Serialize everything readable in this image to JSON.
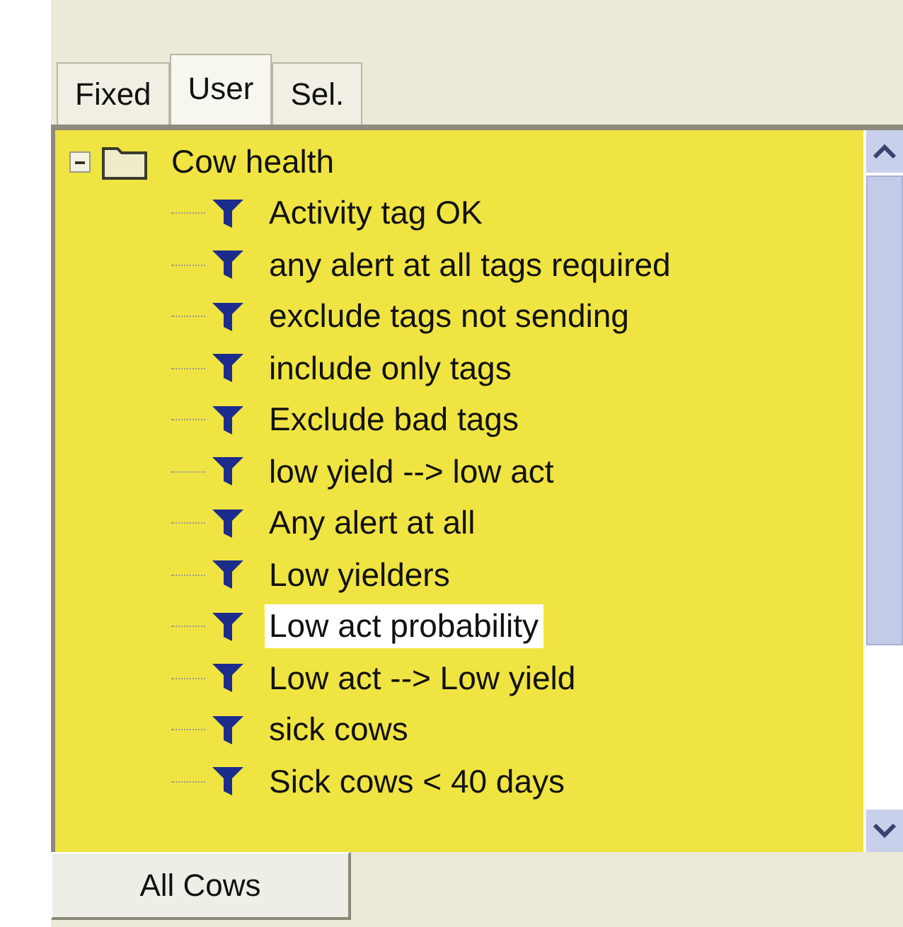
{
  "tabs": [
    {
      "label": "Fixed",
      "selected": false
    },
    {
      "label": "User",
      "selected": true
    },
    {
      "label": "Sel.",
      "selected": false
    }
  ],
  "tree": {
    "label": "Cow health",
    "expanded": true,
    "selected": false,
    "children": [
      {
        "label": "Activity tag OK",
        "selected": false
      },
      {
        "label": "any alert at all tags required",
        "selected": false
      },
      {
        "label": "exclude tags not sending",
        "selected": false
      },
      {
        "label": "include only tags",
        "selected": false
      },
      {
        "label": "Exclude bad tags",
        "selected": false
      },
      {
        "label": "low yield --> low act",
        "selected": false
      },
      {
        "label": "Any alert at all",
        "selected": false
      },
      {
        "label": "Low yielders",
        "selected": false
      },
      {
        "label": "Low act probability",
        "selected": true
      },
      {
        "label": "Low act --> Low yield",
        "selected": false
      },
      {
        "label": "sick cows",
        "selected": false
      },
      {
        "label": "Sick cows < 40 days",
        "selected": false
      }
    ]
  },
  "bottom_button": {
    "label": "All Cows"
  }
}
